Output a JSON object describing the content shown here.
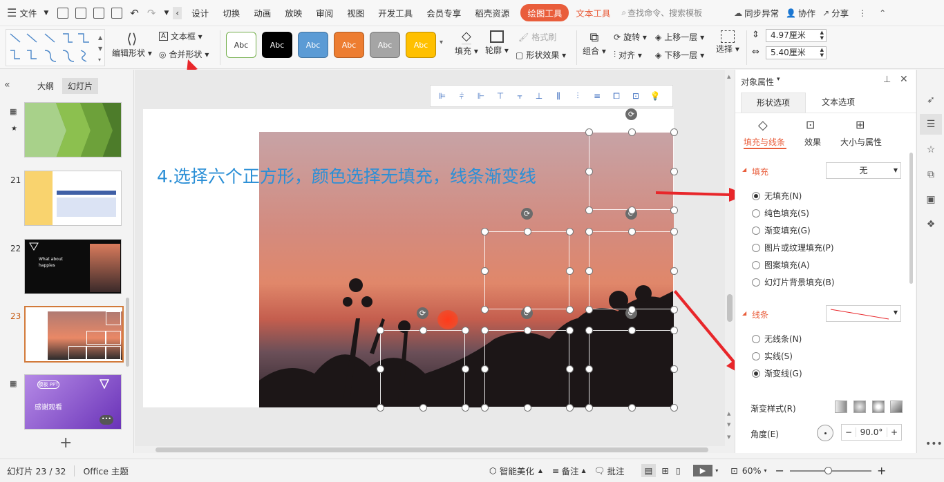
{
  "menubar": {
    "file_label": "文件",
    "tabs": [
      "设计",
      "切换",
      "动画",
      "放映",
      "审阅",
      "视图",
      "开发工具",
      "会员专享",
      "稻壳资源"
    ],
    "draw_tools": "绘图工具",
    "text_tools": "文本工具",
    "search_placeholder": "查找命令、搜索模板",
    "sync": "同步异常",
    "collab": "协作",
    "share": "分享"
  },
  "ribbon": {
    "edit_shape": "编辑形状",
    "textbox": "文本框",
    "merge_shape": "合并形状",
    "styles": [
      "Abc",
      "Abc",
      "Abc",
      "Abc",
      "Abc",
      "Abc"
    ],
    "style_colors": [
      "#ffffff",
      "#000000",
      "#5b9bd5",
      "#ed7d31",
      "#a5a5a5",
      "#ffc000"
    ],
    "style_text_colors": [
      "#333333",
      "#ffffff",
      "#ffffff",
      "#ffffff",
      "#ffffff",
      "#ffffff"
    ],
    "style_borders": [
      "#70ad47",
      "#000000",
      "#41719c",
      "#ae5a21",
      "#787878",
      "#bc8c00"
    ],
    "fill": "填充",
    "outline": "轮廓",
    "format_painter": "格式刷",
    "shape_effect": "形状效果",
    "group": "组合",
    "rotate": "旋转",
    "align": "对齐",
    "bring_forward": "上移一层",
    "send_backward": "下移一层",
    "select": "选择",
    "height": "4.97厘米",
    "width": "5.40厘米"
  },
  "leftpanel": {
    "outline_tab": "大纲",
    "slides_tab": "幻灯片",
    "slide_numbers": [
      "21",
      "22",
      "23"
    ],
    "thumb22_title": "What about happies",
    "thumb24_title": "感谢观看",
    "thumb24_badge": "模板 PPT"
  },
  "slide": {
    "caption": "4.选择六个正方形，颜色选择无填充，线条渐变线"
  },
  "rightpane": {
    "title": "对象属性",
    "tab_shape": "形状选项",
    "tab_text": "文本选项",
    "sub_fill_line": "填充与线条",
    "sub_effect": "效果",
    "sub_size": "大小与属性",
    "fill_section": "填充",
    "fill_value": "无",
    "fill_options": [
      "无填充(N)",
      "纯色填充(S)",
      "渐变填充(G)",
      "图片或纹理填充(P)",
      "图案填充(A)",
      "幻灯片背景填充(B)"
    ],
    "line_section": "线条",
    "line_options": [
      "无线条(N)",
      "实线(S)",
      "渐变线(G)"
    ],
    "gradient_style": "渐变样式(R)",
    "angle_label": "角度(E)",
    "angle_value": "90.0°"
  },
  "status": {
    "slide_info": "幻灯片 23 / 32",
    "theme": "Office 主题",
    "beautify": "智能美化",
    "notes": "备注",
    "comments": "批注",
    "zoom": "60%"
  }
}
